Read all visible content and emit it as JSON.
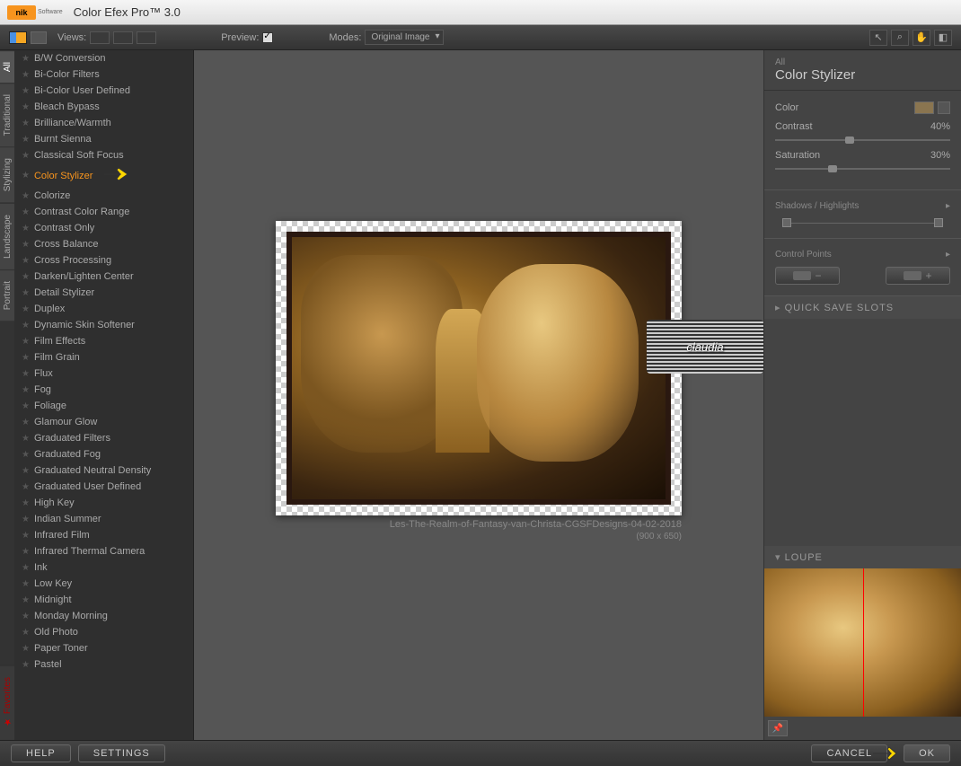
{
  "title": "Color Efex Pro™ 3.0",
  "logo": "nik",
  "logo_sub": "Software",
  "toolbar": {
    "views_label": "Views:",
    "preview_label": "Preview:",
    "modes_label": "Modes:",
    "modes_value": "Original Image"
  },
  "tabs": [
    "All",
    "Traditional",
    "Stylizing",
    "Landscape",
    "Portrait",
    "Favorites"
  ],
  "active_tab": "All",
  "filters": [
    "B/W Conversion",
    "Bi-Color Filters",
    "Bi-Color User Defined",
    "Bleach Bypass",
    "Brilliance/Warmth",
    "Burnt Sienna",
    "Classical Soft Focus",
    "Color Stylizer",
    "Colorize",
    "Contrast Color Range",
    "Contrast Only",
    "Cross Balance",
    "Cross Processing",
    "Darken/Lighten Center",
    "Detail Stylizer",
    "Duplex",
    "Dynamic Skin Softener",
    "Film Effects",
    "Film Grain",
    "Flux",
    "Fog",
    "Foliage",
    "Glamour Glow",
    "Graduated Filters",
    "Graduated Fog",
    "Graduated Neutral Density",
    "Graduated User Defined",
    "High Key",
    "Indian Summer",
    "Infrared Film",
    "Infrared Thermal Camera",
    "Ink",
    "Low Key",
    "Midnight",
    "Monday Morning",
    "Old Photo",
    "Paper Toner",
    "Pastel"
  ],
  "selected_filter": "Color Stylizer",
  "canvas": {
    "caption": "Les-The-Realm-of-Fantasy-van-Christa-CGSFDesigns-04-02-2018",
    "size": "(900 x 650)"
  },
  "watermark": "claudia",
  "right": {
    "all_label": "All",
    "title": "Color Stylizer",
    "color_label": "Color",
    "color_value": "#8a7550",
    "contrast_label": "Contrast",
    "contrast_value": "40%",
    "saturation_label": "Saturation",
    "saturation_value": "30%",
    "shadows_label": "Shadows / Highlights",
    "control_points_label": "Control Points",
    "quick_save_label": "QUICK SAVE SLOTS",
    "loupe_label": "LOUPE"
  },
  "footer": {
    "help": "HELP",
    "settings": "SETTINGS",
    "cancel": "CANCEL",
    "ok": "OK"
  }
}
